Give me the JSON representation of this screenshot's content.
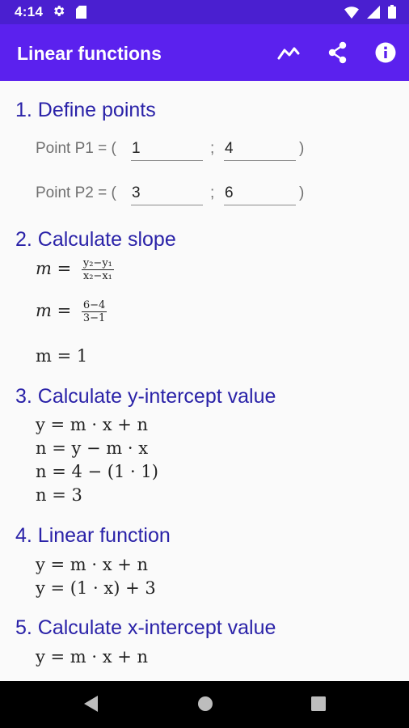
{
  "status_bar": {
    "time": "4:14"
  },
  "app_bar": {
    "title": "Linear functions"
  },
  "section1": {
    "heading": "1. Define points",
    "p1_label": "Point P1 = (",
    "p1_x": "1",
    "p1_y": "4",
    "p2_label": "Point P2 = (",
    "p2_x": "3",
    "p2_y": "6",
    "separator": ";",
    "close_paren": ")"
  },
  "section2": {
    "heading": "2. Calculate slope",
    "formula_lhs": "m =",
    "formula_num": "y₂−y₁",
    "formula_den": "x₂−x₁",
    "subst_lhs": "m =",
    "subst_num": "6−4",
    "subst_den": "3−1",
    "result": "m = 1"
  },
  "section3": {
    "heading": "3. Calculate y-intercept value",
    "lines": [
      "y = m · x + n",
      "n = y − m · x",
      "n = 4 − (1 · 1)",
      "n = 3"
    ]
  },
  "section4": {
    "heading": "4. Linear function",
    "lines": [
      "y = m · x + n",
      "y = (1 · x) + 3"
    ]
  },
  "section5": {
    "heading": "5. Calculate x-intercept value",
    "lines": [
      "y = m · x + n"
    ]
  },
  "colors": {
    "status_bar": "#4a1fd0",
    "app_bar": "#5b21ee",
    "heading": "#2a22a8"
  },
  "icons": {
    "status": [
      "gear-icon",
      "sd-card-icon",
      "wifi-icon",
      "signal-icon",
      "battery-icon"
    ],
    "actions": [
      "graph-icon",
      "share-icon",
      "info-icon"
    ],
    "nav": [
      "back-icon",
      "home-icon",
      "recents-icon"
    ]
  }
}
